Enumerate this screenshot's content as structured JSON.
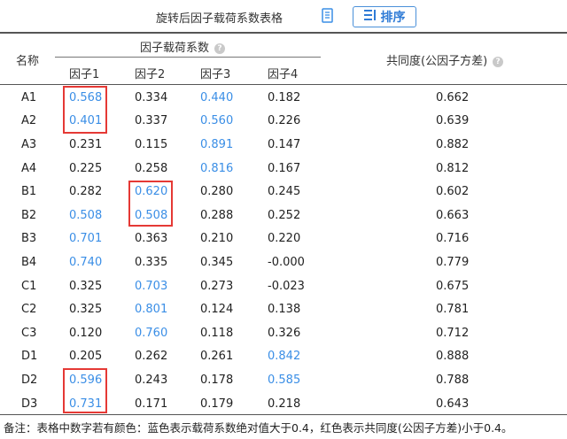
{
  "toolbar": {
    "title": "旋转后因子载荷系数表格",
    "doc_icon": "document-icon",
    "sort_icon": "sort-list-icon",
    "sort_label": "排序"
  },
  "table": {
    "name_header": "名称",
    "loading_header": "因子载荷系数",
    "communality_header": "共同度(公因子方差)",
    "factor_headers": [
      "因子1",
      "因子2",
      "因子3",
      "因子4"
    ],
    "rows": [
      {
        "name": "A1",
        "f": [
          "0.568",
          "0.334",
          "0.440",
          "0.182"
        ],
        "communality": "0.662"
      },
      {
        "name": "A2",
        "f": [
          "0.401",
          "0.337",
          "0.560",
          "0.226"
        ],
        "communality": "0.639"
      },
      {
        "name": "A3",
        "f": [
          "0.231",
          "0.115",
          "0.891",
          "0.147"
        ],
        "communality": "0.882"
      },
      {
        "name": "A4",
        "f": [
          "0.225",
          "0.258",
          "0.816",
          "0.167"
        ],
        "communality": "0.812"
      },
      {
        "name": "B1",
        "f": [
          "0.282",
          "0.620",
          "0.280",
          "0.245"
        ],
        "communality": "0.602"
      },
      {
        "name": "B2",
        "f": [
          "0.508",
          "0.508",
          "0.288",
          "0.252"
        ],
        "communality": "0.663"
      },
      {
        "name": "B3",
        "f": [
          "0.701",
          "0.363",
          "0.210",
          "0.220"
        ],
        "communality": "0.716"
      },
      {
        "name": "B4",
        "f": [
          "0.740",
          "0.335",
          "0.345",
          "-0.000"
        ],
        "communality": "0.779"
      },
      {
        "name": "C1",
        "f": [
          "0.325",
          "0.703",
          "0.273",
          "-0.023"
        ],
        "communality": "0.675"
      },
      {
        "name": "C2",
        "f": [
          "0.325",
          "0.801",
          "0.124",
          "0.138"
        ],
        "communality": "0.781"
      },
      {
        "name": "C3",
        "f": [
          "0.120",
          "0.760",
          "0.118",
          "0.326"
        ],
        "communality": "0.712"
      },
      {
        "name": "D1",
        "f": [
          "0.205",
          "0.262",
          "0.261",
          "0.842"
        ],
        "communality": "0.888"
      },
      {
        "name": "D2",
        "f": [
          "0.596",
          "0.243",
          "0.178",
          "0.585"
        ],
        "communality": "0.788"
      },
      {
        "name": "D3",
        "f": [
          "0.731",
          "0.171",
          "0.179",
          "0.218"
        ],
        "communality": "0.643"
      }
    ]
  },
  "note": "备注：表格中数字若有颜色：蓝色表示载荷系数绝对值大于0.4，红色表示共同度(公因子方差)小于0.4。",
  "colors": {
    "highlight_blue": "#3a8ee6",
    "box_red": "#e53935",
    "button_blue": "#2f7bd6"
  }
}
